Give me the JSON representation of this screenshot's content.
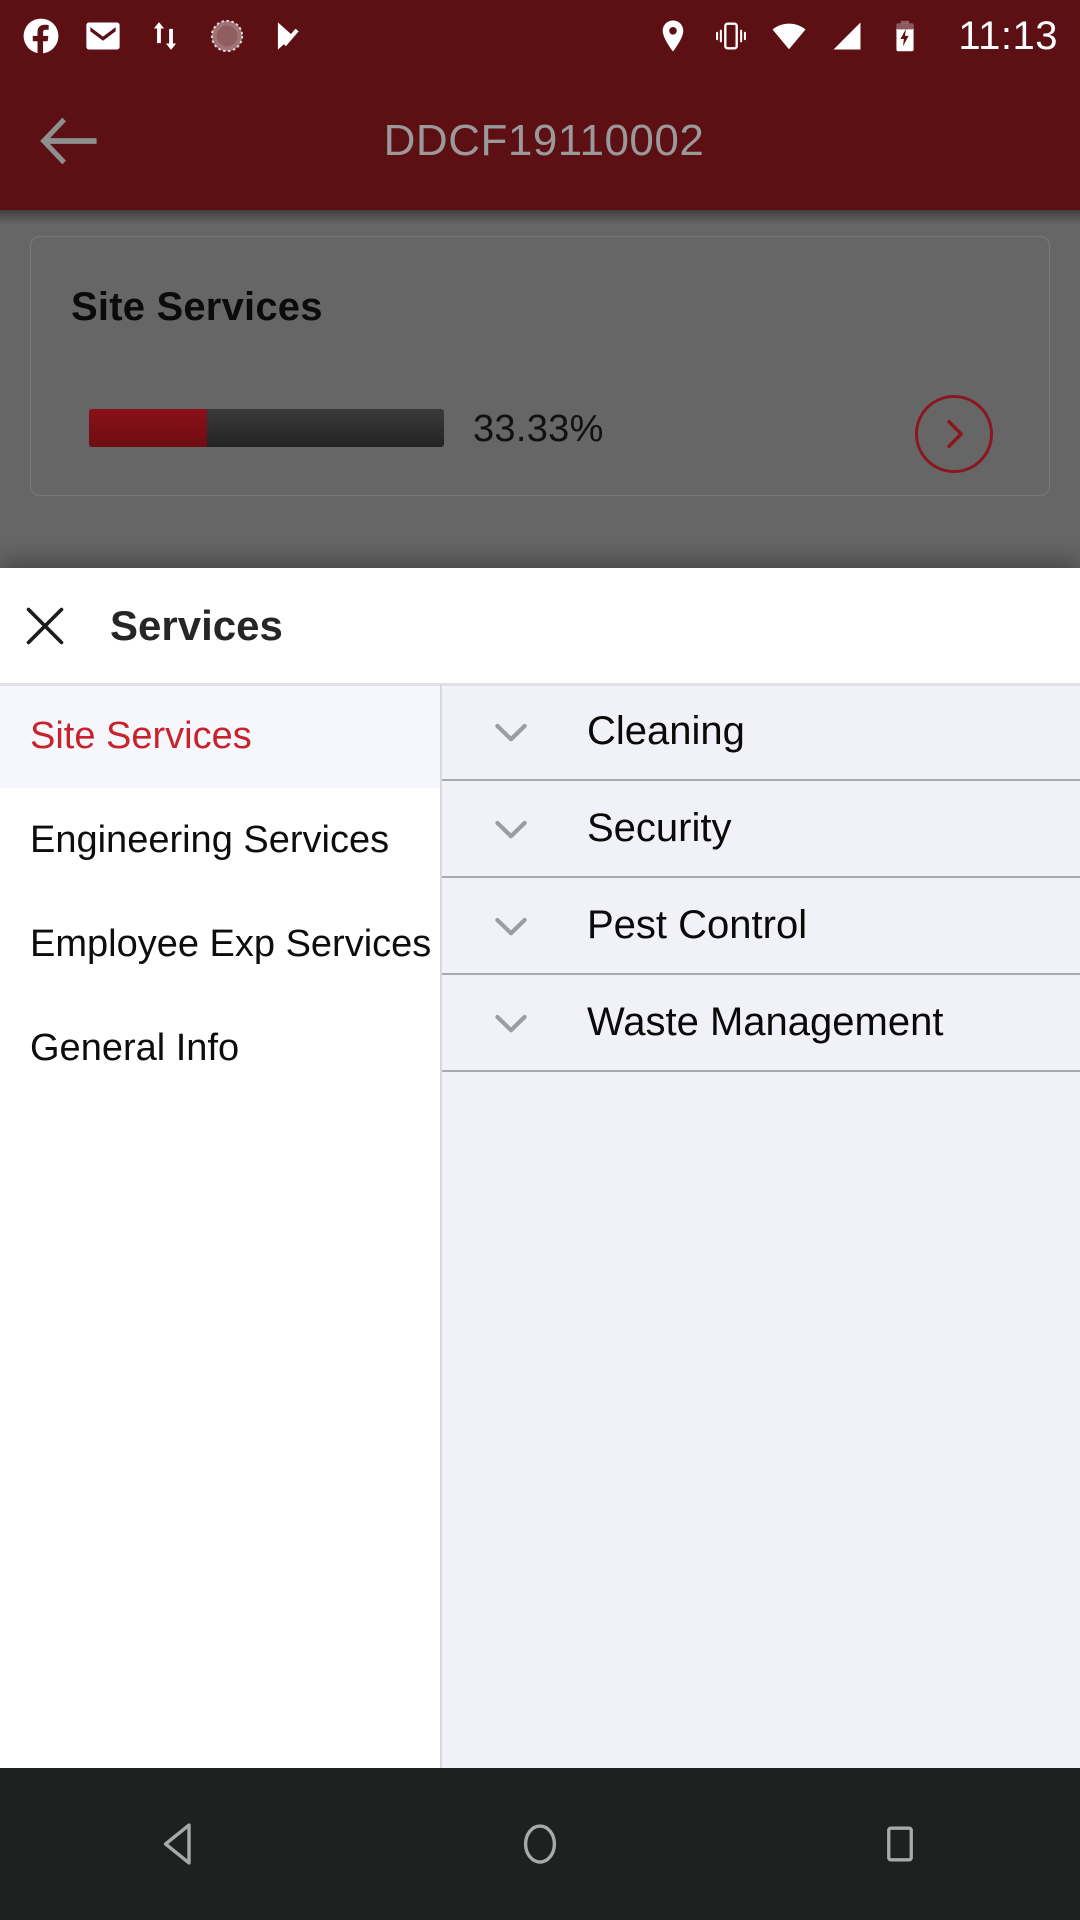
{
  "status_bar": {
    "time": "11:13",
    "left_icons": [
      "facebook-icon",
      "gmail-icon",
      "data-transfer-icon",
      "sync-progress-icon",
      "task-check-icon"
    ],
    "right_icons": [
      "location-icon",
      "vibrate-icon",
      "wifi-icon",
      "cellular-signal-icon",
      "battery-charging-icon"
    ]
  },
  "app_bar": {
    "back_icon": "back-arrow-icon",
    "title": "DDCF19110002"
  },
  "background_card": {
    "title": "Site Services",
    "progress_percent_label": "33.33%",
    "progress_value": 33.33,
    "next_icon": "chevron-right-icon"
  },
  "sheet": {
    "close_icon": "close-icon",
    "title": "Services",
    "categories": [
      {
        "label": "Site Services",
        "selected": true
      },
      {
        "label": "Engineering Services",
        "selected": false
      },
      {
        "label": "Employee Exp Services",
        "selected": false
      },
      {
        "label": "General Info",
        "selected": false
      }
    ],
    "services": [
      {
        "label": "Cleaning",
        "expand_icon": "chevron-down-icon",
        "expanded": false
      },
      {
        "label": "Security",
        "expand_icon": "chevron-down-icon",
        "expanded": false
      },
      {
        "label": "Pest Control",
        "expand_icon": "chevron-down-icon",
        "expanded": false
      },
      {
        "label": "Waste Management",
        "expand_icon": "chevron-down-icon",
        "expanded": false
      }
    ]
  },
  "nav_bar": {
    "back_label": "back-triangle-icon",
    "home_label": "home-circle-icon",
    "recents_label": "recents-square-icon"
  },
  "colors": {
    "brand_maroon": "#5c1014",
    "accent_red": "#c8232c",
    "progress_fill": "#7c1016",
    "sheet_right_bg": "#f1f1f8",
    "selected_row_bg": "#f5f7fc"
  }
}
